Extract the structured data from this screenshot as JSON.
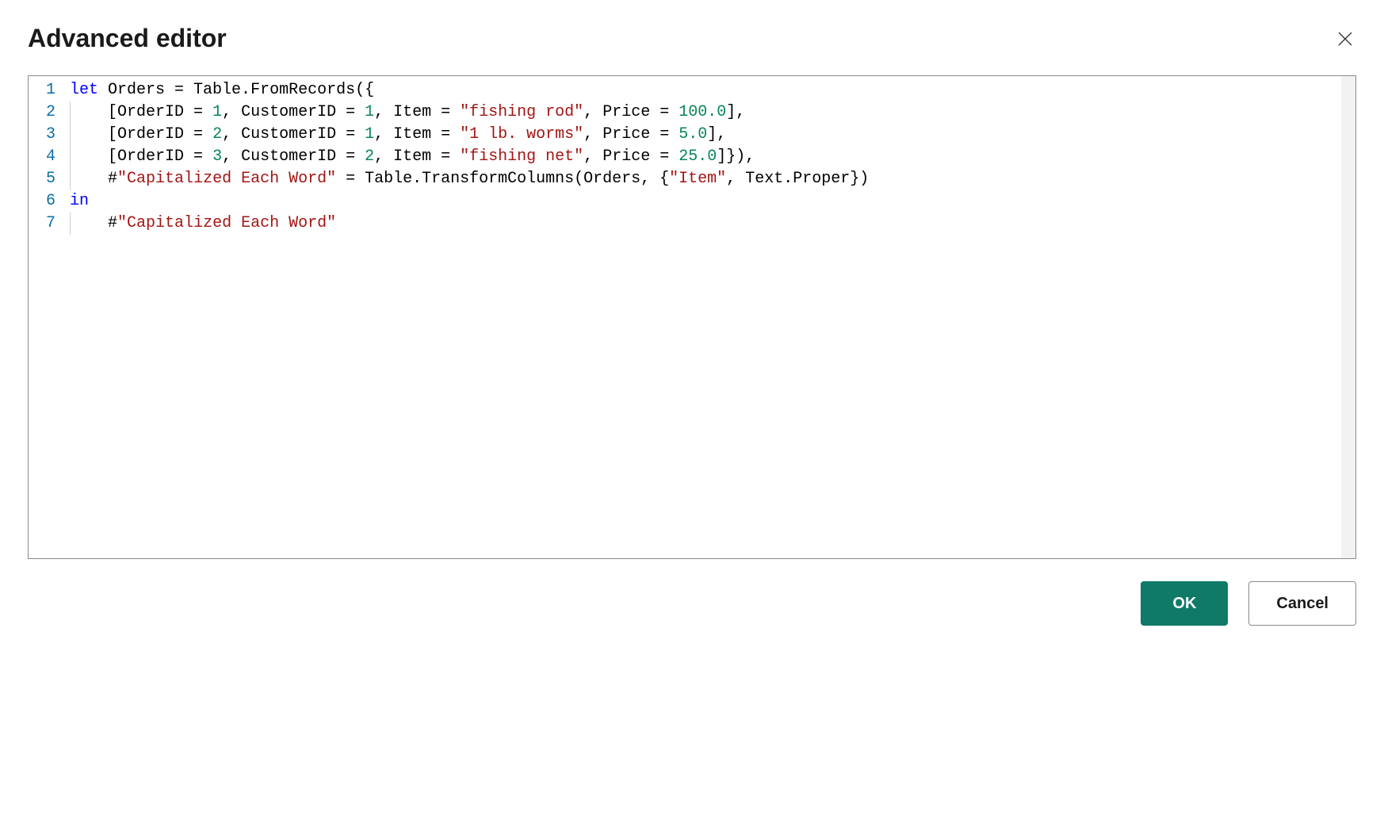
{
  "header": {
    "title": "Advanced editor"
  },
  "editor": {
    "lineNumbers": [
      "1",
      "2",
      "3",
      "4",
      "5",
      "6",
      "7"
    ],
    "lines": [
      {
        "indent": 0,
        "tokens": [
          {
            "t": "keyword",
            "v": "let"
          },
          {
            "t": "plain",
            "v": " Orders = Table.FromRecords({"
          }
        ]
      },
      {
        "indent": 1,
        "tokens": [
          {
            "t": "plain",
            "v": "[OrderID = "
          },
          {
            "t": "number",
            "v": "1"
          },
          {
            "t": "plain",
            "v": ", CustomerID = "
          },
          {
            "t": "number",
            "v": "1"
          },
          {
            "t": "plain",
            "v": ", Item = "
          },
          {
            "t": "string",
            "v": "\"fishing rod\""
          },
          {
            "t": "plain",
            "v": ", Price = "
          },
          {
            "t": "number",
            "v": "100.0"
          },
          {
            "t": "plain",
            "v": "],"
          }
        ]
      },
      {
        "indent": 1,
        "tokens": [
          {
            "t": "plain",
            "v": "[OrderID = "
          },
          {
            "t": "number",
            "v": "2"
          },
          {
            "t": "plain",
            "v": ", CustomerID = "
          },
          {
            "t": "number",
            "v": "1"
          },
          {
            "t": "plain",
            "v": ", Item = "
          },
          {
            "t": "string",
            "v": "\"1 lb. worms\""
          },
          {
            "t": "plain",
            "v": ", Price = "
          },
          {
            "t": "number",
            "v": "5.0"
          },
          {
            "t": "plain",
            "v": "],"
          }
        ]
      },
      {
        "indent": 1,
        "tokens": [
          {
            "t": "plain",
            "v": "[OrderID = "
          },
          {
            "t": "number",
            "v": "3"
          },
          {
            "t": "plain",
            "v": ", CustomerID = "
          },
          {
            "t": "number",
            "v": "2"
          },
          {
            "t": "plain",
            "v": ", Item = "
          },
          {
            "t": "string",
            "v": "\"fishing net\""
          },
          {
            "t": "plain",
            "v": ", Price = "
          },
          {
            "t": "number",
            "v": "25.0"
          },
          {
            "t": "plain",
            "v": "]}),"
          }
        ]
      },
      {
        "indent": 1,
        "tokens": [
          {
            "t": "plain",
            "v": "#"
          },
          {
            "t": "string",
            "v": "\"Capitalized Each Word\""
          },
          {
            "t": "plain",
            "v": " = Table.TransformColumns(Orders, {"
          },
          {
            "t": "string",
            "v": "\"Item\""
          },
          {
            "t": "plain",
            "v": ", Text.Proper})"
          }
        ]
      },
      {
        "indent": 0,
        "tokens": [
          {
            "t": "keyword",
            "v": "in"
          }
        ]
      },
      {
        "indent": 1,
        "tokens": [
          {
            "t": "plain",
            "v": "#"
          },
          {
            "t": "string",
            "v": "\"Capitalized Each Word\""
          }
        ]
      }
    ]
  },
  "footer": {
    "ok_label": "OK",
    "cancel_label": "Cancel"
  }
}
